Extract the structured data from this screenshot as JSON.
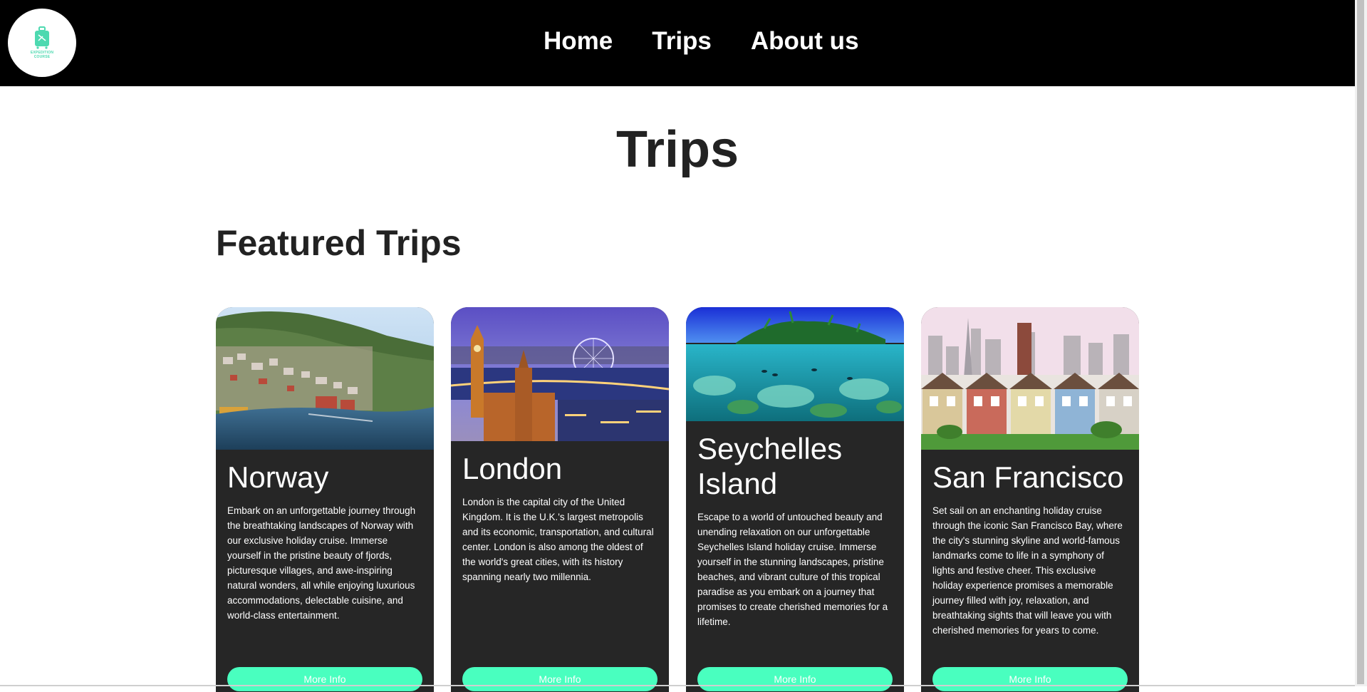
{
  "nav": {
    "logo_text_line1": "EXPEDITION",
    "logo_text_line2": "COURSE",
    "links": [
      "Home",
      "Trips",
      "About us"
    ]
  },
  "page": {
    "title": "Trips",
    "section_title": "Featured Trips"
  },
  "cards": [
    {
      "title": "Norway",
      "text": "Embark on an unforgettable journey through the breathtaking landscapes of Norway with our exclusive holiday cruise. Immerse yourself in the pristine beauty of fjords, picturesque villages, and awe-inspiring natural wonders, all while enjoying luxurious accommodations, delectable cuisine, and world-class entertainment.",
      "button": "More Info"
    },
    {
      "title": "London",
      "text": "London is the capital city of the United Kingdom. It is the U.K.'s largest metropolis and its economic, transportation, and cultural center. London is also among the oldest of the world's great cities, with its history spanning nearly two millennia.",
      "button": "More Info"
    },
    {
      "title": "Seychelles Island",
      "text": "Escape to a world of untouched beauty and unending relaxation on our unforgettable Seychelles Island holiday cruise. Immerse yourself in the stunning landscapes, pristine beaches, and vibrant culture of this tropical paradise as you embark on a journey that promises to create cherished memories for a lifetime.",
      "button": "More Info"
    },
    {
      "title": "San Francisco",
      "text": "Set sail on an enchanting holiday cruise through the iconic San Francisco Bay, where the city's stunning skyline and world-famous landmarks come to life in a symphony of lights and festive cheer. This exclusive holiday experience promises a memorable journey filled with joy, relaxation, and breathtaking sights that will leave you with cherished memories for years to come.",
      "button": "More Info"
    }
  ],
  "colors": {
    "nav_bg": "#000000",
    "card_bg": "#262626",
    "button_bg": "#49ffbf",
    "brand_accent": "#4dd9b0",
    "heading_text": "#222222"
  },
  "icons": {
    "logo": "suitcase-icon"
  }
}
